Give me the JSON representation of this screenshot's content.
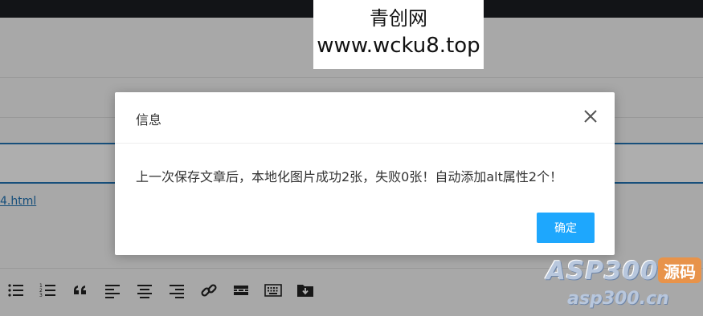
{
  "background": {
    "link_text": "4.html"
  },
  "toolbar": {
    "items": [
      {
        "name": "bullet-list-icon"
      },
      {
        "name": "numbered-list-icon"
      },
      {
        "name": "blockquote-icon"
      },
      {
        "name": "align-left-icon"
      },
      {
        "name": "align-center-icon"
      },
      {
        "name": "align-right-icon"
      },
      {
        "name": "link-icon"
      },
      {
        "name": "read-more-icon"
      },
      {
        "name": "keyboard-icon"
      },
      {
        "name": "folder-download-icon"
      }
    ]
  },
  "watermark": {
    "title": "青创网",
    "url": "www.wcku8.top"
  },
  "dialog": {
    "title": "信息",
    "message": "上一次保存文章后，本地化图片成功2张，失败0张！自动添加alt属性2个！",
    "confirm_label": "确定",
    "close_icon": "close-icon",
    "accent_color": "#1ea7fd"
  },
  "logo": {
    "main": "ASP300",
    "badge": "源码",
    "url": "asp300.cn"
  }
}
